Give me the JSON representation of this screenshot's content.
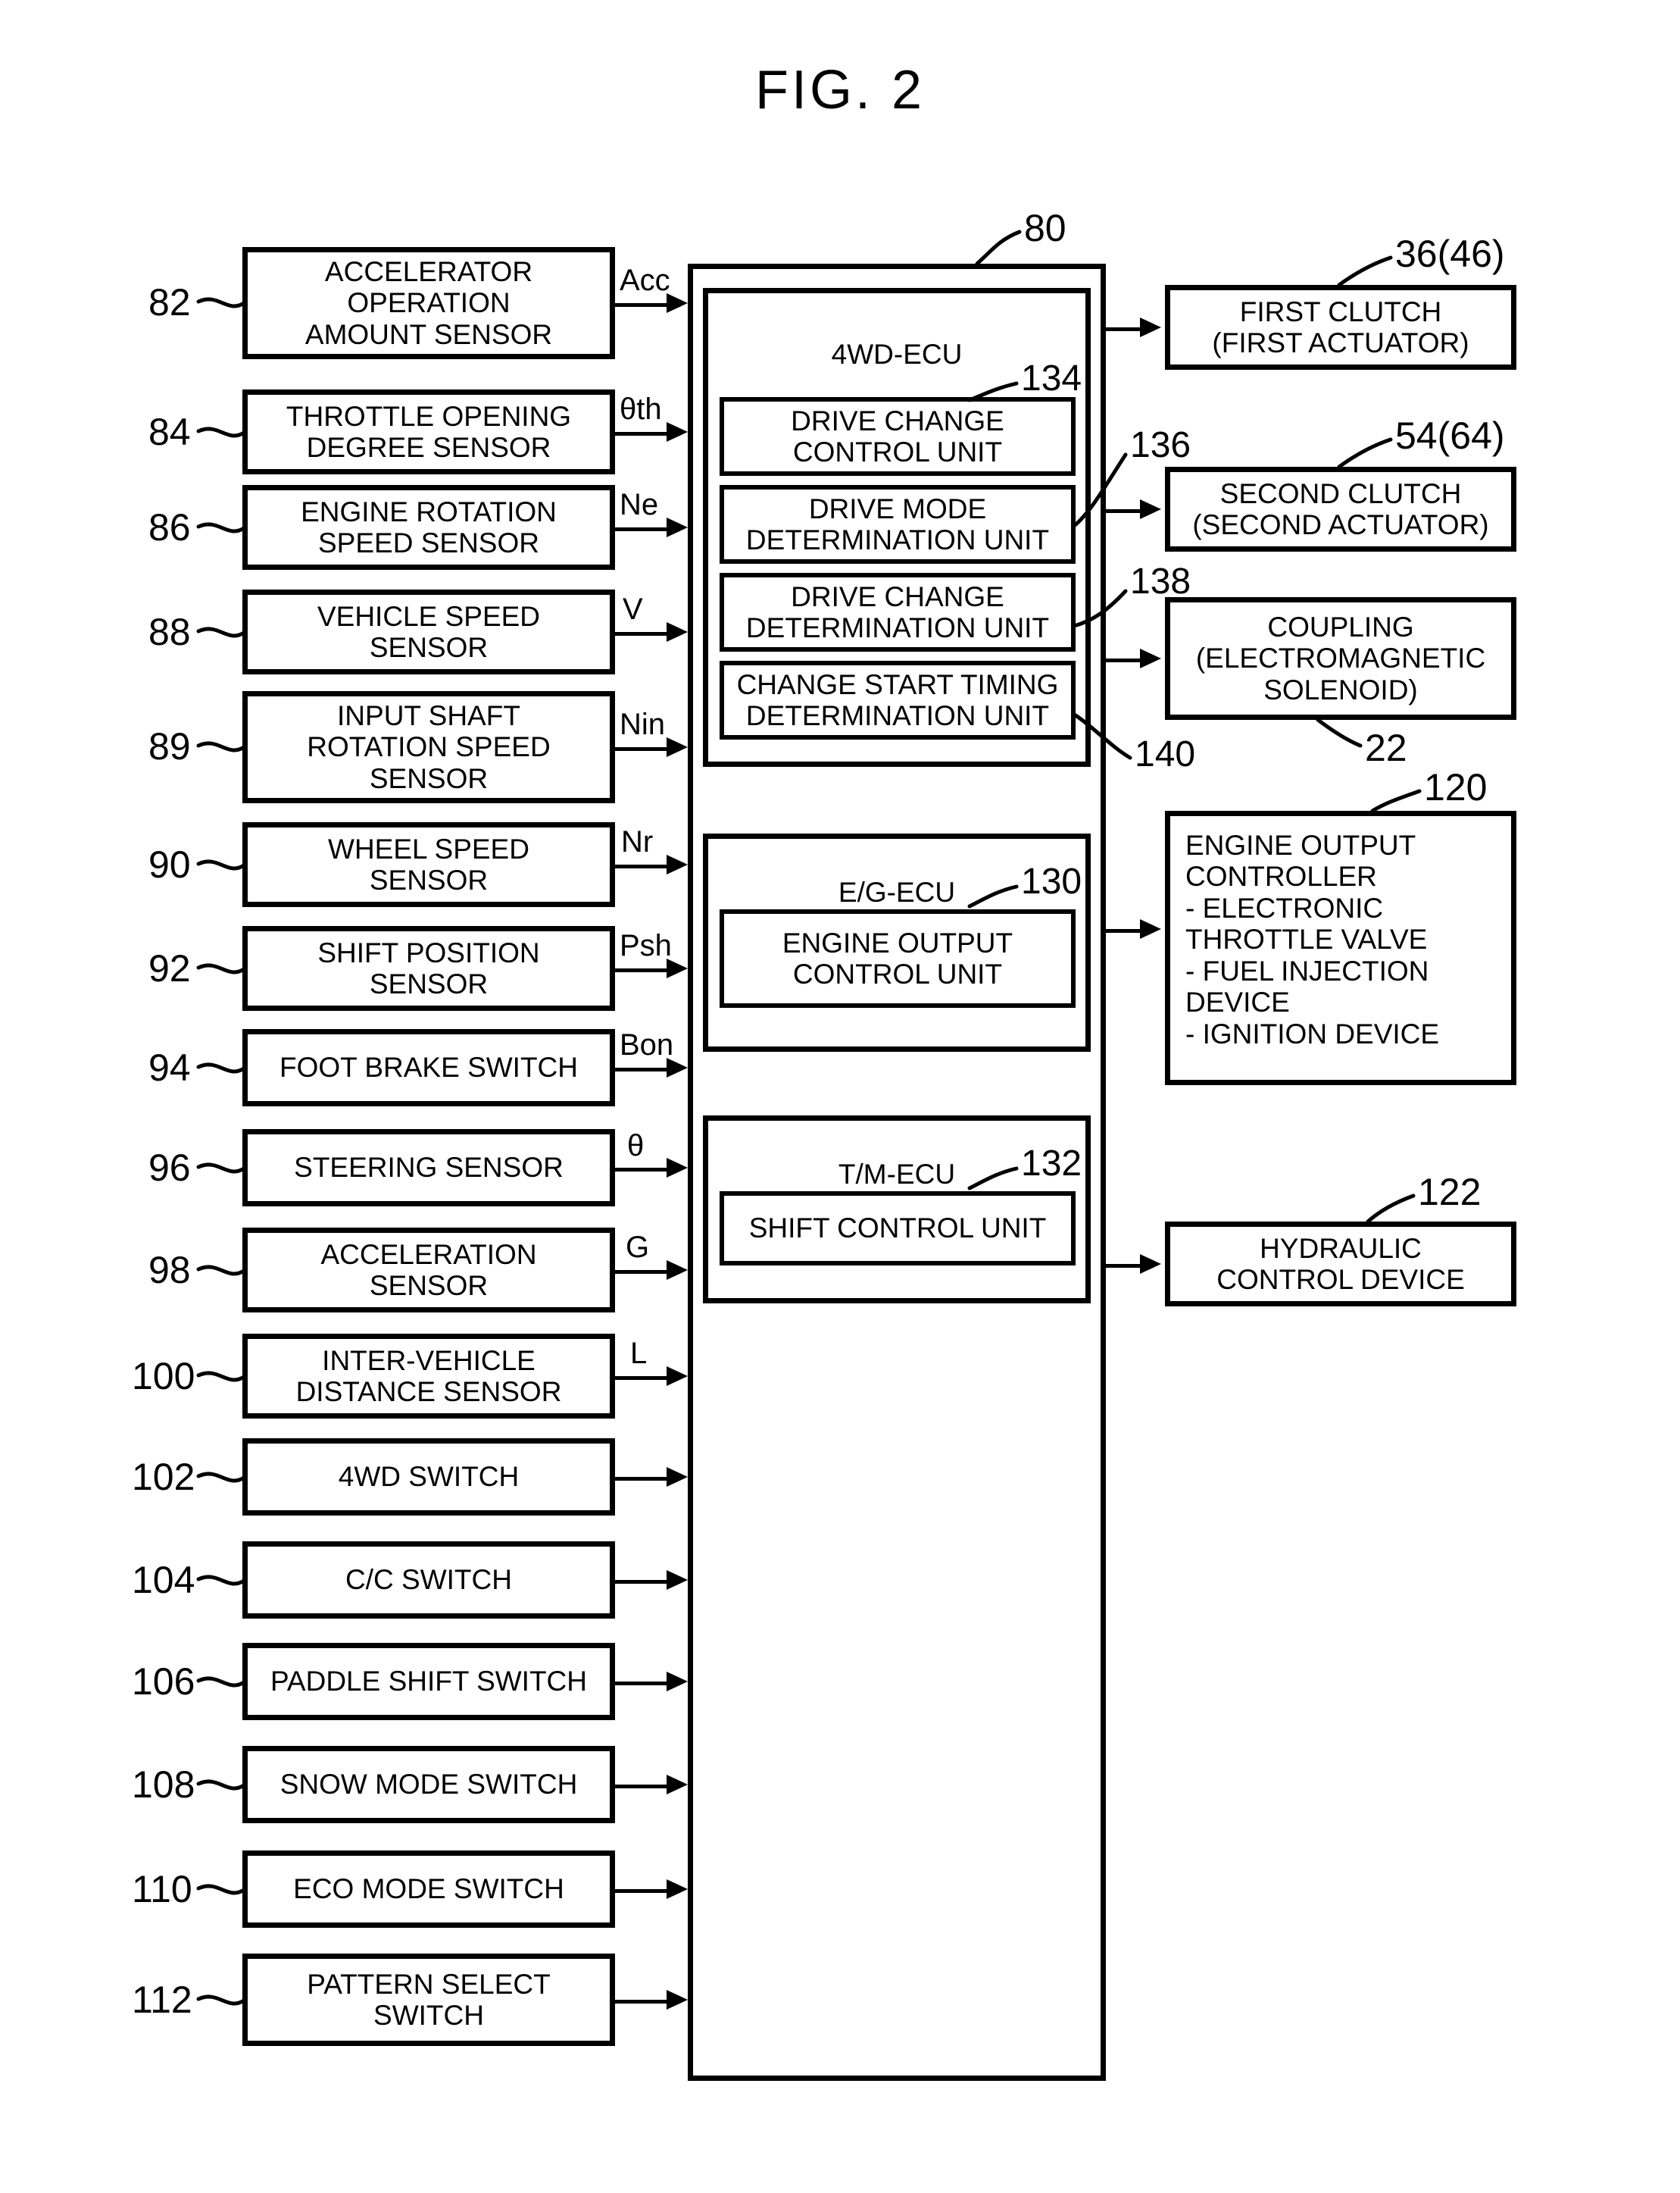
{
  "figure": {
    "title": "FIG. 2"
  },
  "inputs": [
    {
      "ref": "82",
      "label": "ACCELERATOR\nOPERATION\nAMOUNT SENSOR",
      "signal": "Acc"
    },
    {
      "ref": "84",
      "label": "THROTTLE OPENING\nDEGREE SENSOR",
      "signal": "θth"
    },
    {
      "ref": "86",
      "label": "ENGINE ROTATION\nSPEED SENSOR",
      "signal": "Ne"
    },
    {
      "ref": "88",
      "label": "VEHICLE SPEED\nSENSOR",
      "signal": "V"
    },
    {
      "ref": "89",
      "label": "INPUT SHAFT\nROTATION SPEED\nSENSOR",
      "signal": "Nin"
    },
    {
      "ref": "90",
      "label": "WHEEL SPEED\nSENSOR",
      "signal": "Nr"
    },
    {
      "ref": "92",
      "label": "SHIFT POSITION\nSENSOR",
      "signal": "Psh"
    },
    {
      "ref": "94",
      "label": "FOOT BRAKE SWITCH",
      "signal": "Bon"
    },
    {
      "ref": "96",
      "label": "STEERING SENSOR",
      "signal": "θ"
    },
    {
      "ref": "98",
      "label": "ACCELERATION\nSENSOR",
      "signal": "G"
    },
    {
      "ref": "100",
      "label": "INTER-VEHICLE\nDISTANCE SENSOR",
      "signal": "L"
    },
    {
      "ref": "102",
      "label": "4WD SWITCH",
      "signal": ""
    },
    {
      "ref": "104",
      "label": "C/C SWITCH",
      "signal": ""
    },
    {
      "ref": "106",
      "label": "PADDLE SHIFT SWITCH",
      "signal": ""
    },
    {
      "ref": "108",
      "label": "SNOW MODE SWITCH",
      "signal": ""
    },
    {
      "ref": "110",
      "label": "ECO MODE SWITCH",
      "signal": ""
    },
    {
      "ref": "112",
      "label": "PATTERN SELECT\nSWITCH",
      "signal": ""
    }
  ],
  "ecu": {
    "ref": "80",
    "groups": [
      {
        "name": "4WD-ECU",
        "units": [
          {
            "ref": "134",
            "label": "DRIVE CHANGE\nCONTROL UNIT"
          },
          {
            "ref": "136",
            "label": "DRIVE MODE\nDETERMINATION UNIT"
          },
          {
            "ref": "138",
            "label": "DRIVE CHANGE\nDETERMINATION UNIT"
          },
          {
            "ref": "140",
            "label": "CHANGE START TIMING\nDETERMINATION UNIT"
          }
        ]
      },
      {
        "name": "E/G-ECU",
        "units": [
          {
            "ref": "130",
            "label": "ENGINE OUTPUT\nCONTROL UNIT"
          }
        ]
      },
      {
        "name": "T/M-ECU",
        "units": [
          {
            "ref": "132",
            "label": "SHIFT CONTROL UNIT"
          }
        ]
      }
    ]
  },
  "outputs": [
    {
      "ref": "36(46)",
      "label": "FIRST CLUTCH\n(FIRST ACTUATOR)"
    },
    {
      "ref": "54(64)",
      "label": "SECOND CLUTCH\n(SECOND ACTUATOR)"
    },
    {
      "ref": "22",
      "label": "COUPLING\n(ELECTROMAGNETIC\nSOLENOID)"
    },
    {
      "ref": "120",
      "label": "ENGINE OUTPUT\nCONTROLLER\n  - ELECTRONIC\n    THROTTLE VALVE\n  - FUEL INJECTION\n    DEVICE\n  - IGNITION DEVICE"
    },
    {
      "ref": "122",
      "label": "HYDRAULIC\nCONTROL DEVICE"
    }
  ]
}
